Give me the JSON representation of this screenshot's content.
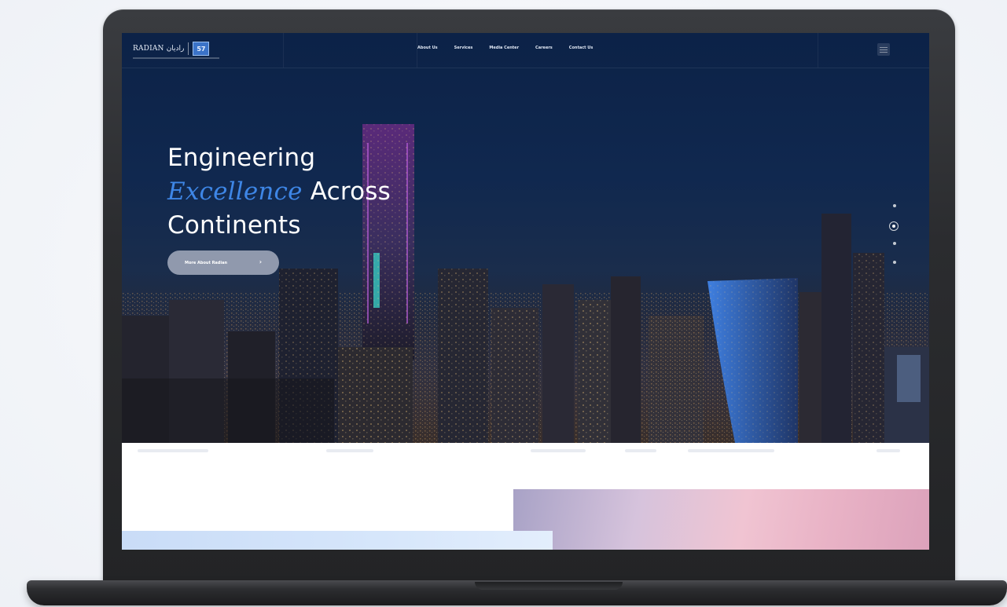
{
  "header": {
    "logo_text": "RADIAN رادیان",
    "logo_badge": "57",
    "nav_links": [
      "About Us",
      "Services",
      "Media Center",
      "Careers",
      "Contact Us"
    ]
  },
  "hero": {
    "headline_line1": "Engineering",
    "headline_em": "Excellence",
    "headline_line2_rest": " Across",
    "headline_line3": "Continents",
    "cta_label": "More About Radian",
    "cta_arrow": "›"
  },
  "colors": {
    "accent": "#3e86e6",
    "hero_bg": "#0c2247"
  },
  "icons": {
    "menu": "hamburger-menu-icon",
    "cta": "arrow-right-icon"
  }
}
